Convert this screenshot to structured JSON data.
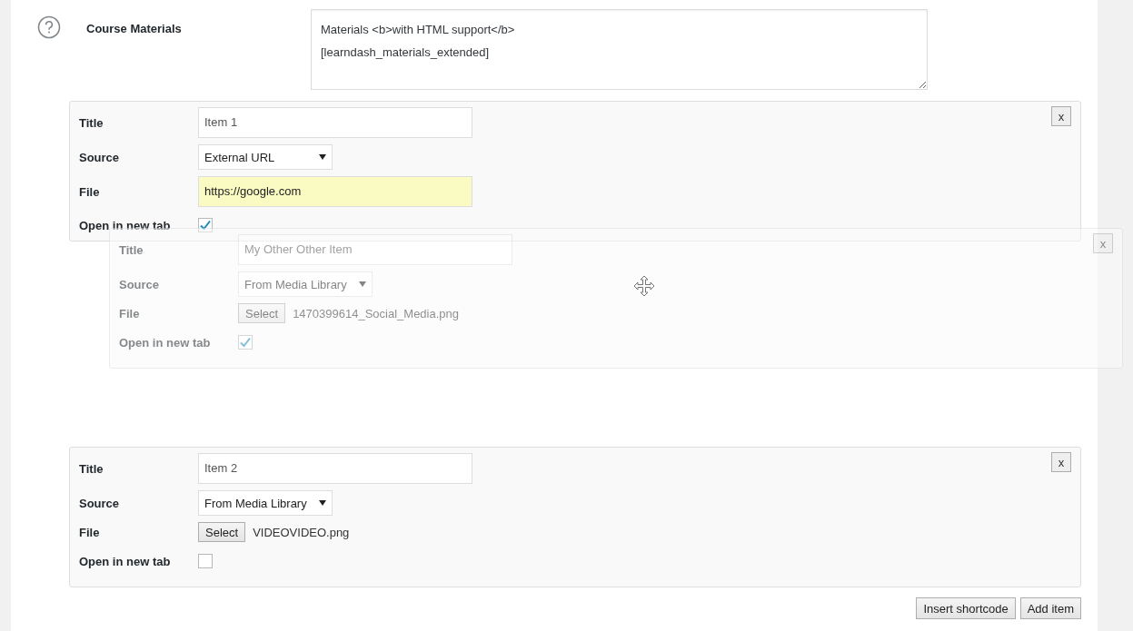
{
  "section": {
    "label": "Course Materials",
    "content": "Materials <b>with HTML support</b>\n[learndash_materials_extended]"
  },
  "items": [
    {
      "dragging": false,
      "close": "x",
      "fields": [
        {
          "kind": "text",
          "label": "Title",
          "value": "Item 1"
        },
        {
          "kind": "select",
          "label": "Source",
          "value": "External URL"
        },
        {
          "kind": "url",
          "label": "File",
          "value": "https://google.com"
        },
        {
          "kind": "checkbox",
          "label": "Open in new tab",
          "checked": true
        }
      ]
    },
    {
      "dragging": true,
      "close": "x",
      "fields": [
        {
          "kind": "text",
          "label": "Title",
          "value": "My Other Other Item"
        },
        {
          "kind": "select",
          "label": "Source",
          "value": "From Media Library"
        },
        {
          "kind": "media",
          "label": "File",
          "button": "Select",
          "filename": "1470399614_Social_Media.png"
        },
        {
          "kind": "checkbox",
          "label": "Open in new tab",
          "checked": true
        }
      ]
    },
    {
      "dragging": false,
      "close": "x",
      "fields": [
        {
          "kind": "text",
          "label": "Title",
          "value": "Item 2"
        },
        {
          "kind": "select",
          "label": "Source",
          "value": "From Media Library"
        },
        {
          "kind": "media",
          "label": "File",
          "button": "Select",
          "filename": "VIDEOVIDEO.png"
        },
        {
          "kind": "checkbox",
          "label": "Open in new tab",
          "checked": false
        }
      ]
    }
  ],
  "actions": [
    "Insert shortcode",
    "Add item"
  ]
}
